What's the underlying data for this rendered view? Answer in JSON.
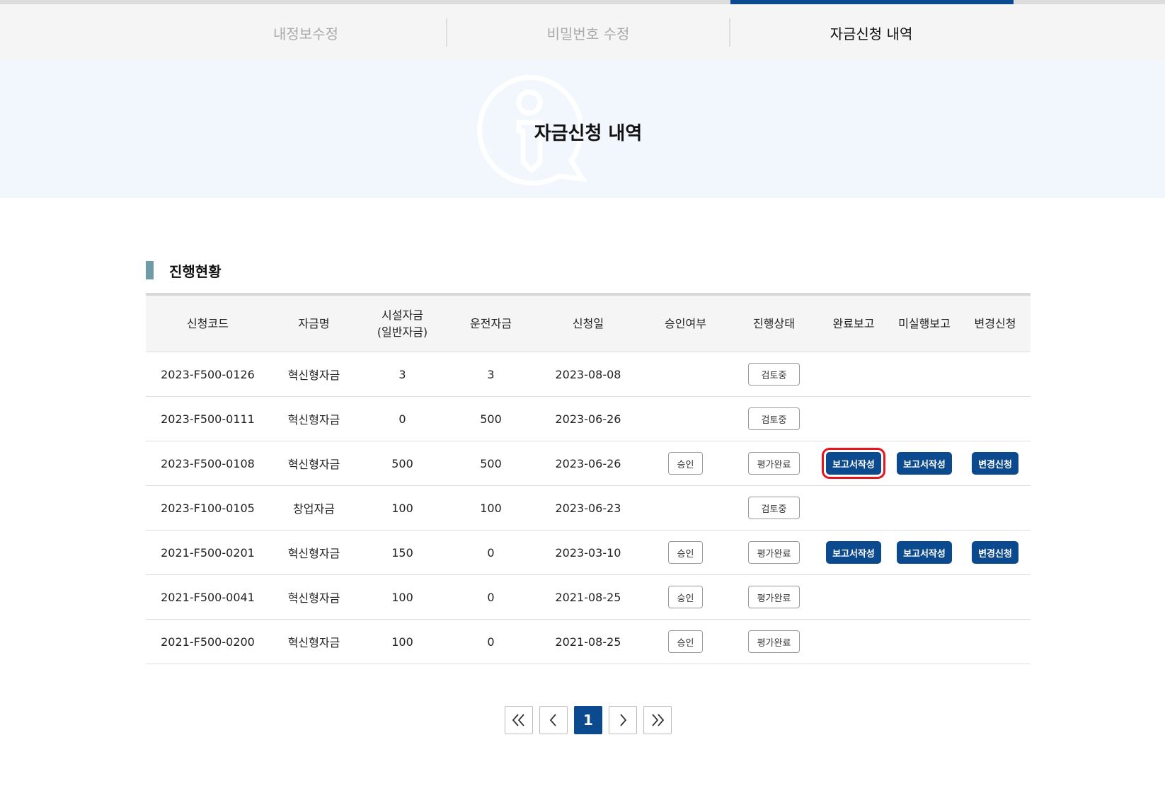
{
  "tabs": [
    {
      "label": "내정보수정",
      "active": false
    },
    {
      "label": "비밀번호 수정",
      "active": false
    },
    {
      "label": "자금신청 내역",
      "active": true
    }
  ],
  "banner": {
    "title": "자금신청 내역",
    "icon": "info-icon"
  },
  "section": {
    "title": "진행현황"
  },
  "table": {
    "headers": [
      "신청코드",
      "자금명",
      "시설자금\n(일반자금)",
      "운전자금",
      "신청일",
      "승인여부",
      "진행상태",
      "완료보고",
      "미실행보고",
      "변경신청"
    ],
    "rows": [
      {
        "code": "2023-F500-0126",
        "fund": "혁신형자금",
        "facility": "3",
        "operating": "3",
        "date": "2023-08-08",
        "approval": "",
        "status": "검토중",
        "completion": "",
        "nonexec": "",
        "change": ""
      },
      {
        "code": "2023-F500-0111",
        "fund": "혁신형자금",
        "facility": "0",
        "operating": "500",
        "date": "2023-06-26",
        "approval": "",
        "status": "검토중",
        "completion": "",
        "nonexec": "",
        "change": ""
      },
      {
        "code": "2023-F500-0108",
        "fund": "혁신형자금",
        "facility": "500",
        "operating": "500",
        "date": "2023-06-26",
        "approval": "승인",
        "status": "평가완료",
        "completion": "보고서작성",
        "nonexec": "보고서작성",
        "change": "변경신청"
      },
      {
        "code": "2023-F100-0105",
        "fund": "창업자금",
        "facility": "100",
        "operating": "100",
        "date": "2023-06-23",
        "approval": "",
        "status": "검토중",
        "completion": "",
        "nonexec": "",
        "change": ""
      },
      {
        "code": "2021-F500-0201",
        "fund": "혁신형자금",
        "facility": "150",
        "operating": "0",
        "date": "2023-03-10",
        "approval": "승인",
        "status": "평가완료",
        "completion": "보고서작성",
        "nonexec": "보고서작성",
        "change": "변경신청"
      },
      {
        "code": "2021-F500-0041",
        "fund": "혁신형자금",
        "facility": "100",
        "operating": "0",
        "date": "2021-08-25",
        "approval": "승인",
        "status": "평가완료",
        "completion": "",
        "nonexec": "",
        "change": ""
      },
      {
        "code": "2021-F500-0200",
        "fund": "혁신형자금",
        "facility": "100",
        "operating": "0",
        "date": "2021-08-25",
        "approval": "승인",
        "status": "평가완료",
        "completion": "",
        "nonexec": "",
        "change": ""
      }
    ]
  },
  "pagination": {
    "current": "1",
    "icons": [
      "first-page-icon",
      "prev-page-icon",
      "next-page-icon",
      "last-page-icon"
    ]
  },
  "colors": {
    "primary": "#0b4a8f",
    "highlight": "#e8141c",
    "section_bar": "#6f9ba6",
    "banner_bg": "#f2f7fd"
  }
}
